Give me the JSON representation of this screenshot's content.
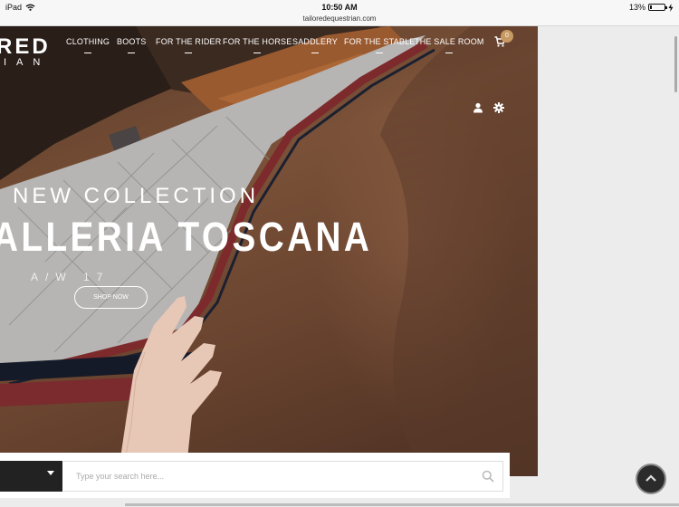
{
  "status_bar": {
    "device": "iPad",
    "time": "10:50 AM",
    "url": "tailoredequestrian.com",
    "battery": "13%",
    "battery_level": 0.13
  },
  "logo": {
    "top": "RED",
    "bottom": "IAN"
  },
  "nav": {
    "items": [
      "CLOTHING",
      "BOOTS",
      "FOR THE RIDER",
      "FOR THE HORSE",
      "SADDLERY",
      "FOR THE STABLE",
      "THE SALE ROOM"
    ],
    "cart_count": "0"
  },
  "hero": {
    "subtitle": "NEW COLLECTION",
    "title": "ALLERIA TOSCANA",
    "season": "A/W 17",
    "cta": "SHOP NOW"
  },
  "search": {
    "placeholder": "Type your search here..."
  },
  "icons": [
    "wifi-icon",
    "charging-icon",
    "cart-icon",
    "user-icon",
    "gear-icon",
    "caret-down-icon",
    "search-icon",
    "chevron-up-icon"
  ],
  "colors": {
    "cart_badge": "#c89a63",
    "search_category": "#222222"
  }
}
